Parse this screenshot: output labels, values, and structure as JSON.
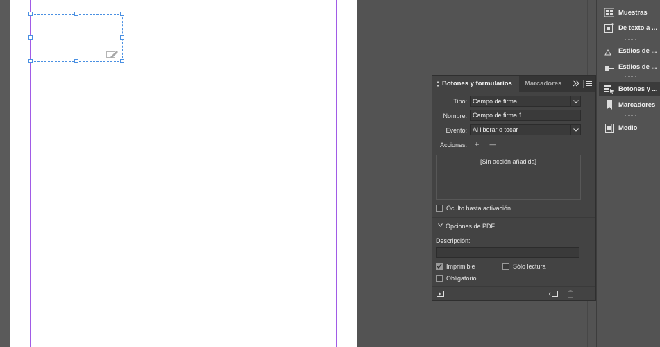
{
  "dock": {
    "items": [
      {
        "label": "Muestras",
        "icon": "swatches-icon"
      },
      {
        "label": "De texto a ...",
        "icon": "text-wrap-icon"
      },
      {
        "label": "Estilos de ...",
        "icon": "object-styles-icon"
      },
      {
        "label": "Estilos de ...",
        "icon": "paragraph-styles-icon"
      },
      {
        "label": "Botones y ...",
        "icon": "buttons-forms-icon"
      },
      {
        "label": "Marcadores",
        "icon": "bookmark-icon"
      },
      {
        "label": "Medio",
        "icon": "media-icon"
      }
    ]
  },
  "panel": {
    "tabs": [
      "Botones y formularios",
      "Marcadores"
    ],
    "tipo_label": "Tipo:",
    "tipo_value": "Campo de firma",
    "nombre_label": "Nombre:",
    "nombre_value": "Campo de firma 1",
    "evento_label": "Evento:",
    "evento_value": "Al liberar o tocar",
    "acciones_label": "Acciones:",
    "add_action": "+",
    "remove_action": "—",
    "no_action_text": "[Sin acción añadida]",
    "hidden_until_label": "Oculto hasta activación",
    "pdf_options_label": "Opciones de PDF",
    "descripcion_label": "Descripción:",
    "descripcion_value": "",
    "imprimible_label": "Imprimible",
    "imprimible_checked": true,
    "solo_lectura_label": "Sólo lectura",
    "solo_lectura_checked": false,
    "obligatorio_label": "Obligatorio",
    "obligatorio_checked": false,
    "hidden_until_checked": false
  },
  "colors": {
    "accent_selection": "#4a90e2",
    "margin_guide": "#a15be6",
    "panel_bg": "#434343"
  }
}
